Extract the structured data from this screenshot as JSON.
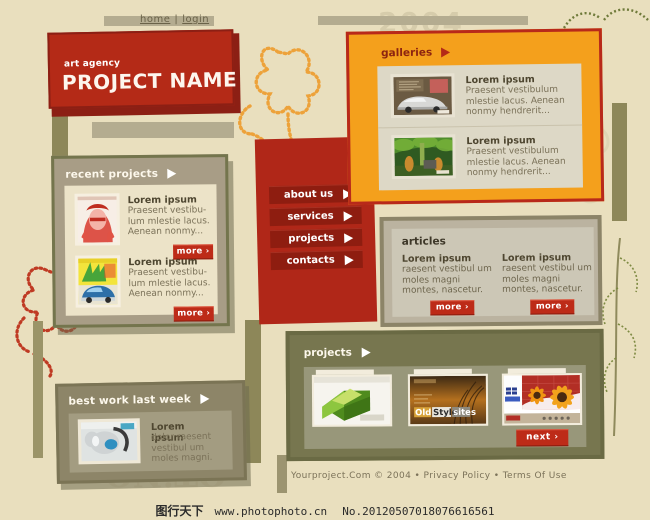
{
  "colors": {
    "background": "#e9dfbe",
    "brand_red": "#b42a17",
    "dark_red": "#8c1f14",
    "orange": "#f4a01c",
    "olive": "#8d8759",
    "olive_dark": "#74754d",
    "tan": "#b0a88c",
    "cream": "#ece3c8",
    "button_red": "#bd2b18"
  },
  "header": {
    "nav": [
      {
        "label": "home",
        "name": "nav-link-home"
      },
      {
        "label": "login",
        "name": "nav-link-login"
      }
    ],
    "separator": "|",
    "ghost_year": "2004"
  },
  "logo": {
    "sub": "art agency",
    "title": "PROJECT NAME"
  },
  "menu": {
    "items": [
      {
        "label": "about us"
      },
      {
        "label": "services"
      },
      {
        "label": "projects"
      },
      {
        "label": "contacts"
      }
    ],
    "arrow_icon": "triangle-right-icon"
  },
  "recent_projects": {
    "title": "recent projects",
    "arrow_icon": "triangle-right-icon",
    "items": [
      {
        "heading": "Lorem ipsum",
        "body": "Praesent vestibu-lum mlestie lacus. Aenean nonmy...",
        "more_label": "more ›",
        "thumb_name": "thumb-portrait-red"
      },
      {
        "heading": "Lorem ipsum",
        "body": "Praesent vestibu-lum mlestie lacus. Aenean nonmy...",
        "more_label": "more ›",
        "thumb_name": "thumb-blue-car-poster"
      }
    ]
  },
  "best_work": {
    "title": "best work last week",
    "arrow_icon": "triangle-right-icon",
    "item": {
      "heading": "Lorem ipsum",
      "body": "dolor raesent vestibul um moles magni.",
      "thumb_name": "thumb-robot-device"
    }
  },
  "galleries": {
    "title": "galleries",
    "arrow_icon": "triangle-right-icon",
    "items": [
      {
        "heading": "Lorem ipsum",
        "body": "Praesent vestibulum mlestie lacus. Aenean nonmy hendrerit...",
        "thumb_name": "thumb-silver-car-site"
      },
      {
        "heading": "Lorem ipsum",
        "body": "Praesent vestibulum mlestie lacus. Aenean nonmy hendrerit...",
        "thumb_name": "thumb-jungle-scene-site"
      }
    ]
  },
  "articles": {
    "title": "articles",
    "columns": [
      {
        "heading": "Lorem ipsum",
        "body": "raesent vestibul um moles magni montes, nascetur.",
        "more_label": "more ›"
      },
      {
        "heading": "Lorem ipsum",
        "body": "raesent vestibul um moles magni montes, nascetur.",
        "more_label": "more ›"
      }
    ]
  },
  "projects": {
    "title": "projects",
    "arrow_icon": "triangle-right-icon",
    "next_label": "next ›",
    "cards": [
      {
        "thumb_name": "thumb-green-cube-site",
        "caption": ""
      },
      {
        "thumb_name": "thumb-oldstyle-sites",
        "caption": "OldStyle sites"
      },
      {
        "thumb_name": "thumb-sunflower-site",
        "caption": ""
      }
    ]
  },
  "footer": {
    "text": "Yourproject.Com © 2004 • Privacy Policy • Terms Of Use"
  },
  "watermark": {
    "cn": "图行天下",
    "url": "www.photophoto.cn",
    "number": "No.20120507018076616561"
  }
}
